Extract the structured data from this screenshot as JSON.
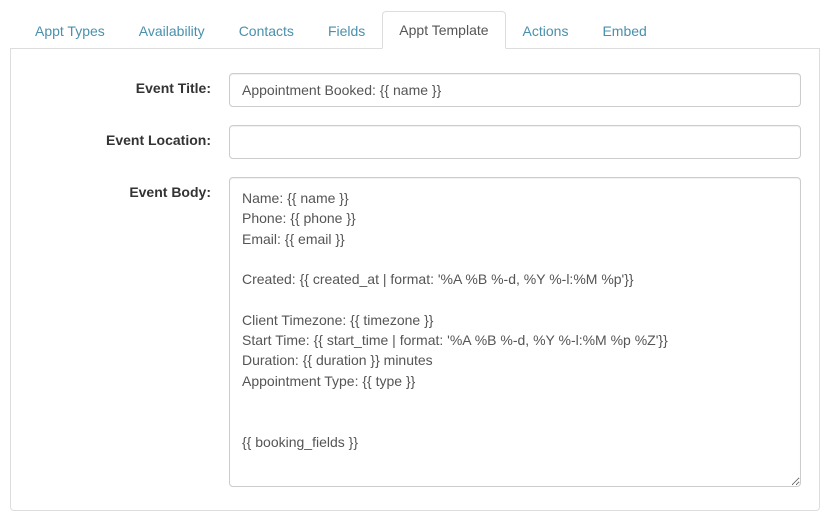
{
  "tabs": [
    {
      "label": "Appt Types",
      "active": false
    },
    {
      "label": "Availability",
      "active": false
    },
    {
      "label": "Contacts",
      "active": false
    },
    {
      "label": "Fields",
      "active": false
    },
    {
      "label": "Appt Template",
      "active": true
    },
    {
      "label": "Actions",
      "active": false
    },
    {
      "label": "Embed",
      "active": false
    }
  ],
  "labels": {
    "event_title": "Event Title:",
    "event_location": "Event Location:",
    "event_body": "Event Body:"
  },
  "fields": {
    "event_title": "Appointment Booked: {{ name }}",
    "event_location": "",
    "event_body": "Name: {{ name }}\nPhone: {{ phone }}\nEmail: {{ email }}\n\nCreated: {{ created_at | format: '%A %B %-d, %Y %-l:%M %p'}}\n\nClient Timezone: {{ timezone }}\nStart Time: {{ start_time | format: '%A %B %-d, %Y %-l:%M %p %Z'}}\nDuration: {{ duration }} minutes\nAppointment Type: {{ type }}\n\n\n{{ booking_fields }}"
  }
}
